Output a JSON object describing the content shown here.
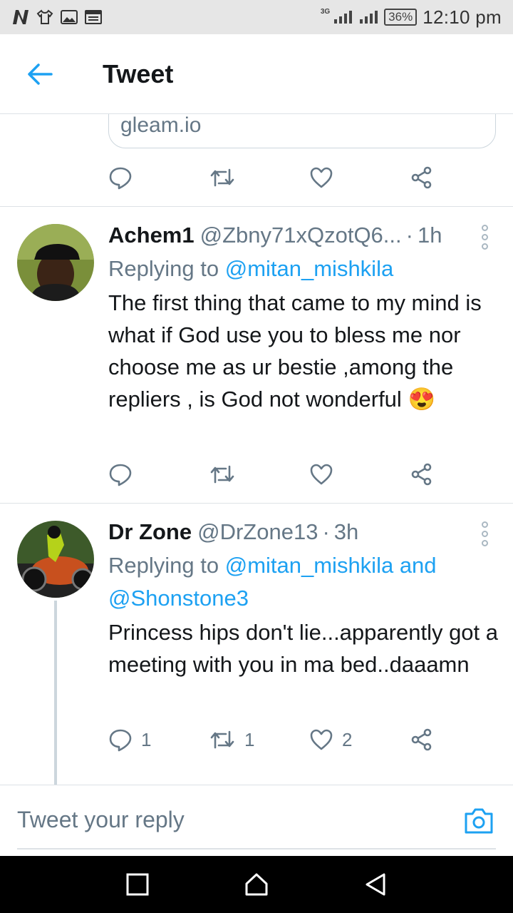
{
  "status_bar": {
    "network": "3G",
    "battery": "36%",
    "time": "12:10 pm"
  },
  "header": {
    "title": "Tweet"
  },
  "previous_card": {
    "link_text": "gleam.io"
  },
  "tweets": [
    {
      "name": "Achem1",
      "handle": "@Zbny71xQzotQ6...",
      "time": "1h",
      "replying_prefix": "Replying to ",
      "replying_to": "@mitan_mishkila",
      "replying_to_2": "",
      "body": "The first thing that came to my mind is what if God use you to bless me  nor choose me as ur bestie ,among the repliers , is God not wonderful",
      "emoji": "😍",
      "reply_count": "",
      "retweet_count": "",
      "like_count": ""
    },
    {
      "name": "Dr Zone",
      "handle": "@DrZone13",
      "time": "3h",
      "replying_prefix": "Replying to ",
      "replying_to": "@mitan_mishkila and",
      "replying_to_2": "@Shonstone3",
      "body": "Princess hips don't lie...apparently got a meeting with you in ma bed..daaamn",
      "reply_count": "1",
      "retweet_count": "1",
      "like_count": "2"
    }
  ],
  "composer": {
    "placeholder": "Tweet your reply"
  },
  "icons": {
    "accent": "#1da1f2",
    "muted": "#657786"
  }
}
